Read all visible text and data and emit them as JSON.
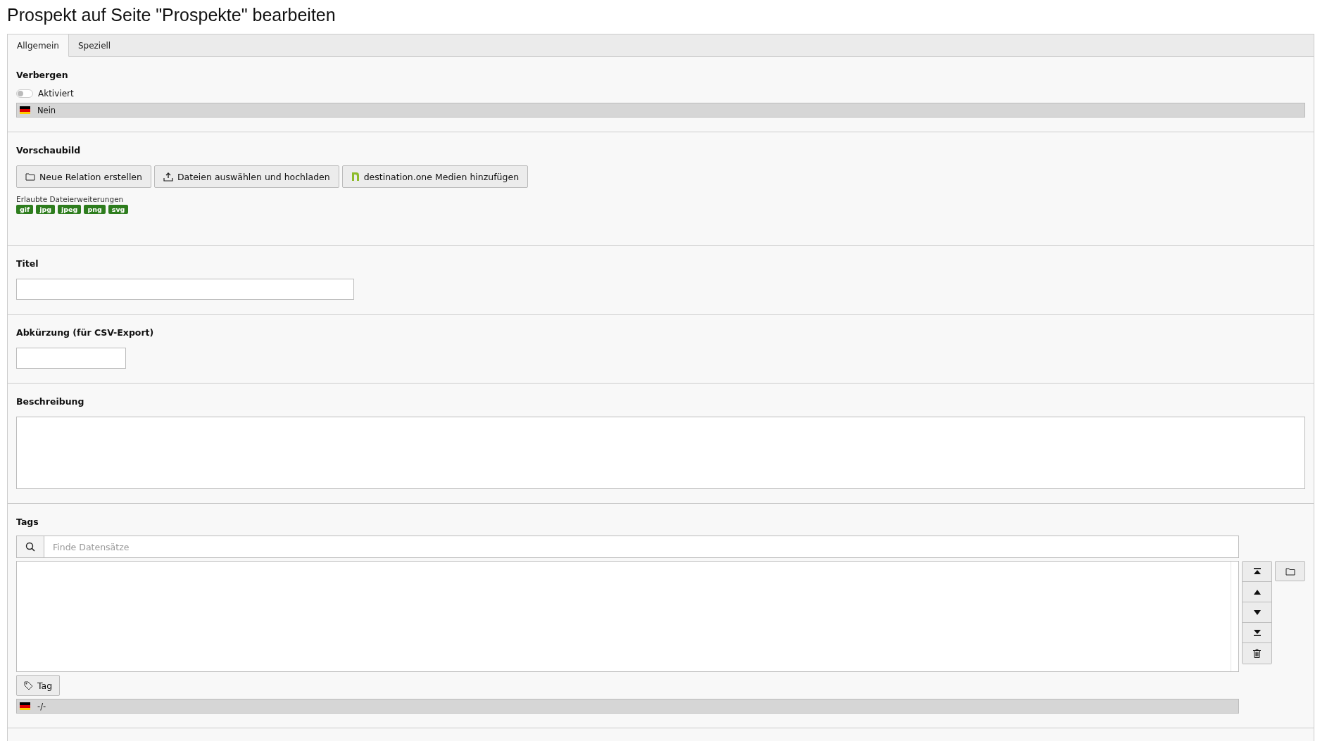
{
  "title": "Prospekt auf Seite \"Prospekte\" bearbeiten",
  "tabs": [
    {
      "label": "Allgemein",
      "selected": true
    },
    {
      "label": "Speziell",
      "selected": false
    }
  ],
  "hide_section": {
    "label": "Verbergen",
    "toggle": {
      "label": "Aktiviert",
      "on": false
    },
    "language_value": "Nein"
  },
  "preview_section": {
    "label": "Vorschaubild",
    "buttons": [
      {
        "label": "Neue Relation erstellen",
        "kind": "folder"
      },
      {
        "label": "Dateien auswählen und hochladen",
        "kind": "upload"
      },
      {
        "label": "destination.one Medien hinzufügen",
        "kind": "brand"
      }
    ],
    "allowed_label": "Erlaubte Dateierweiterungen",
    "extensions": [
      "gif",
      "jpg",
      "jpeg",
      "png",
      "svg"
    ]
  },
  "title_section": {
    "label": "Titel"
  },
  "abbreviation_section": {
    "label": "Abkürzung (für CSV-Export)"
  },
  "description_section": {
    "label": "Beschreibung"
  },
  "tags_section": {
    "label": "Tags",
    "search": {
      "placeholder": "Finde Datensätze"
    },
    "add_button": "Tag",
    "language_value": "-/-"
  }
}
